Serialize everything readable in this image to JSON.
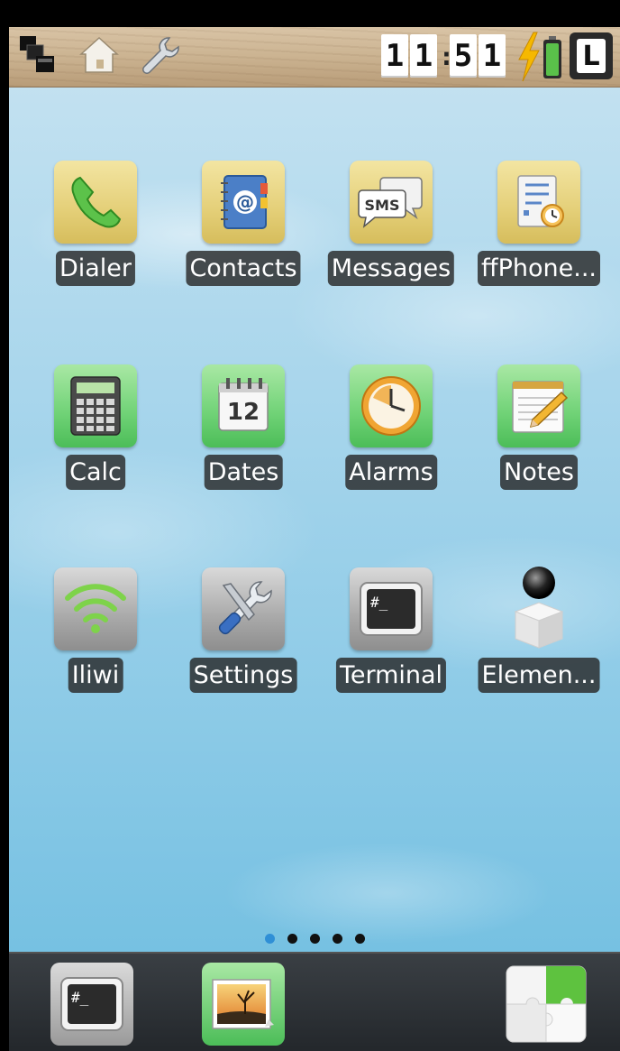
{
  "status_bar": {
    "icons": [
      "task-switcher-icon",
      "home-icon",
      "wrench-icon"
    ],
    "clock": {
      "h1": "1",
      "h2": "1",
      "sep": ":",
      "m1": "5",
      "m2": "1"
    },
    "charging_icon": "lightning-bolt-icon",
    "battery_icon": "battery-icon",
    "lock_label": "L"
  },
  "apps": [
    {
      "label": "Dialer",
      "icon": "phone-icon",
      "style": "yellow"
    },
    {
      "label": "Contacts",
      "icon": "address-book-icon",
      "style": "yellow"
    },
    {
      "label": "Messages",
      "icon": "sms-bubbles-icon",
      "icon_text": "SMS",
      "style": "yellow"
    },
    {
      "label": "ffPhone...",
      "icon": "task-list-clock-icon",
      "style": "yellow"
    },
    {
      "label": "Calc",
      "icon": "calculator-icon",
      "style": "green"
    },
    {
      "label": "Dates",
      "icon": "calendar-icon",
      "icon_text": "12",
      "style": "green"
    },
    {
      "label": "Alarms",
      "icon": "alarm-clock-icon",
      "style": "green"
    },
    {
      "label": "Notes",
      "icon": "notepad-pencil-icon",
      "style": "green"
    },
    {
      "label": "Iliwi",
      "icon": "wifi-icon",
      "style": "gray"
    },
    {
      "label": "Settings",
      "icon": "tools-icon",
      "style": "gray"
    },
    {
      "label": "Terminal",
      "icon": "terminal-icon",
      "icon_text": "#_",
      "style": "gray"
    },
    {
      "label": "Elemen...",
      "icon": "sphere-cube-icon",
      "style": "none"
    }
  ],
  "pager": {
    "count": 5,
    "active_index": 0
  },
  "dock": [
    {
      "name": "dock-terminal",
      "icon": "terminal-icon",
      "icon_text": "#_"
    },
    {
      "name": "dock-gallery",
      "icon": "image-icon"
    },
    {
      "name": "dock-puzzle",
      "icon": "puzzle-icon"
    }
  ],
  "colors": {
    "sky_top": "#c7e3f1",
    "sky_bottom": "#6dbde0",
    "label_bg": "#282828",
    "dot_active": "#2f8fd6",
    "dot_inactive": "#111111"
  }
}
